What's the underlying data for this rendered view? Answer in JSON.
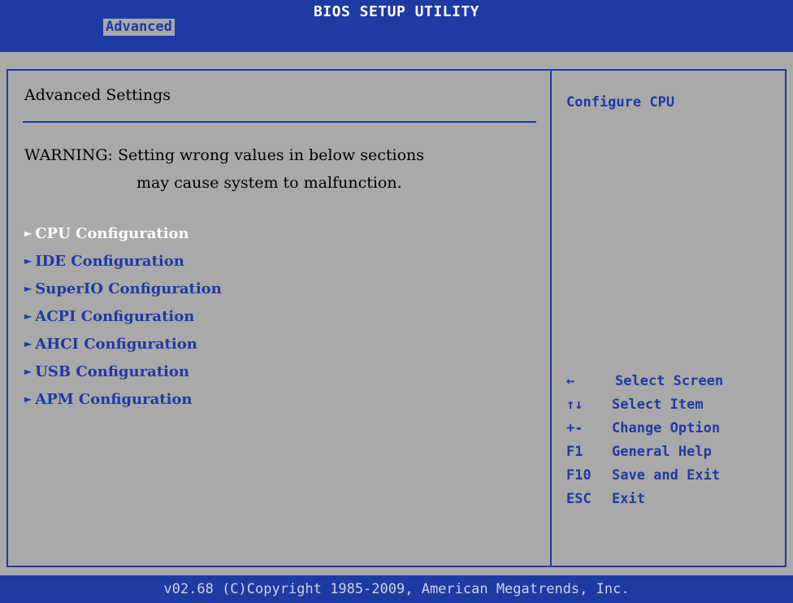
{
  "header": {
    "title": "BIOS SETUP UTILITY",
    "active_tab": "Advanced"
  },
  "main": {
    "section_title": "Advanced Settings",
    "warning_line1": "WARNING: Setting wrong values in below sections",
    "warning_line2": "may cause system to malfunction.",
    "menu": [
      {
        "label": "CPU Configuration",
        "selected": true
      },
      {
        "label": "IDE Configuration",
        "selected": false
      },
      {
        "label": "SuperIO Configuration",
        "selected": false
      },
      {
        "label": "ACPI Configuration",
        "selected": false
      },
      {
        "label": "AHCI Configuration",
        "selected": false
      },
      {
        "label": "USB Configuration",
        "selected": false
      },
      {
        "label": "APM Configuration",
        "selected": false
      }
    ],
    "submenu_arrow": "►"
  },
  "help": {
    "text": "Configure CPU",
    "keys": [
      {
        "key": "←",
        "action": "Select Screen"
      },
      {
        "key": "↑↓",
        "action": "Select Item"
      },
      {
        "key": "+-",
        "action": "Change Option"
      },
      {
        "key": "F1",
        "action": "General Help"
      },
      {
        "key": "F10",
        "action": "Save and Exit"
      },
      {
        "key": "ESC",
        "action": "Exit"
      }
    ]
  },
  "footer": {
    "text": "v02.68 (C)Copyright 1985-2009, American Megatrends, Inc."
  },
  "colors": {
    "accent": "#1e3aa3",
    "background": "#a9a9a9",
    "selected_text": "#ffffff"
  }
}
